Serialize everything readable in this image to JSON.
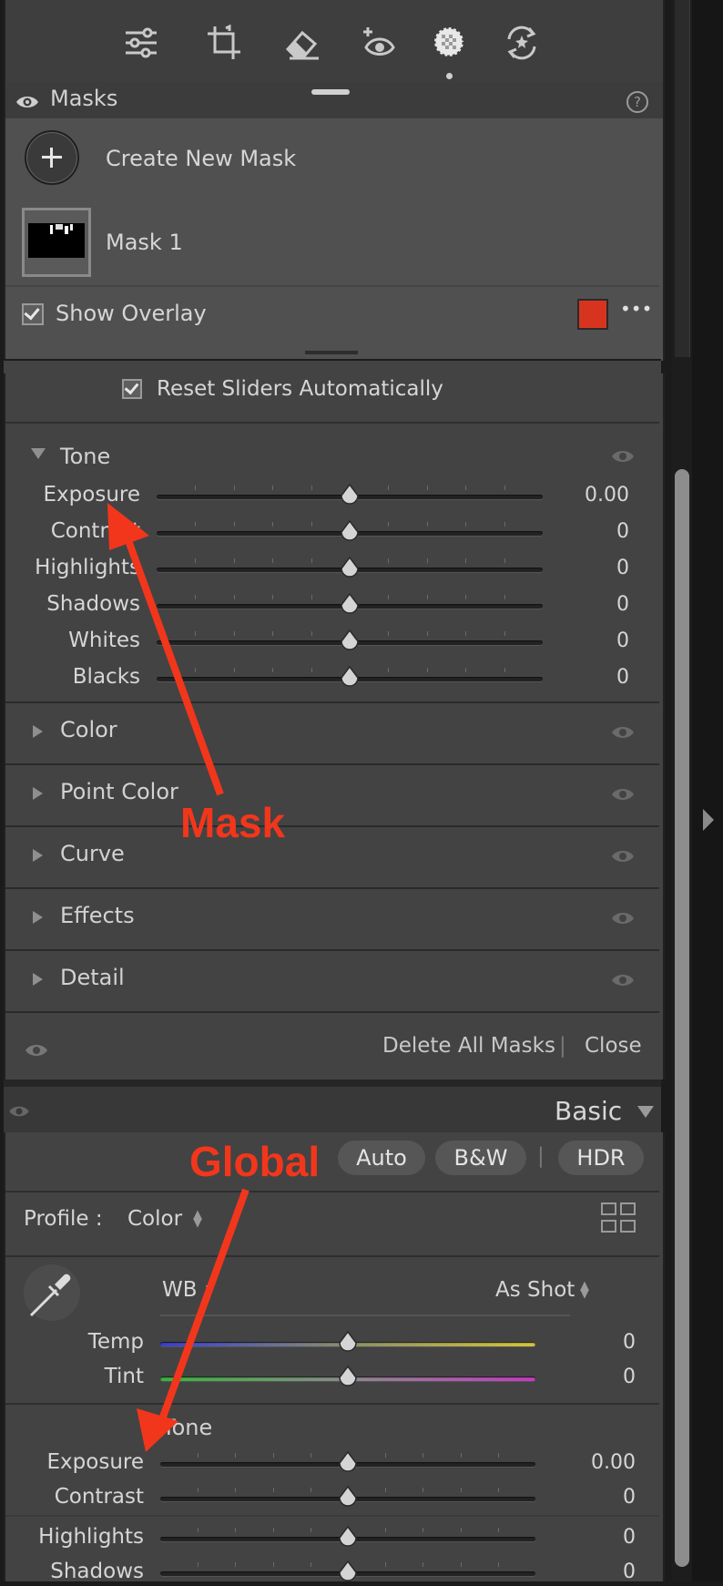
{
  "toolbar": {
    "tools": [
      {
        "icon": "edit-sliders-icon"
      },
      {
        "icon": "crop-icon"
      },
      {
        "icon": "remove-eraser-icon"
      },
      {
        "icon": "red-eye-icon"
      },
      {
        "icon": "masking-icon",
        "active": true
      },
      {
        "icon": "presets-icon"
      }
    ]
  },
  "masks_panel": {
    "title": "Masks",
    "help": "?",
    "create_new_mask": "Create New Mask",
    "mask_item": "Mask 1",
    "show_overlay": "Show Overlay",
    "overlay_color": "#d7341f",
    "more": "•••"
  },
  "mask_adjust": {
    "reset_sliders": "Reset Sliders Automatically",
    "tone_title": "Tone",
    "sliders": [
      {
        "label": "Exposure",
        "value": "0.00"
      },
      {
        "label": "Contrast",
        "value": "0"
      },
      {
        "label": "Highlights",
        "value": "0"
      },
      {
        "label": "Shadows",
        "value": "0"
      },
      {
        "label": "Whites",
        "value": "0"
      },
      {
        "label": "Blacks",
        "value": "0"
      }
    ],
    "sections": [
      "Color",
      "Point Color",
      "Curve",
      "Effects",
      "Detail"
    ],
    "delete_all": "Delete All Masks",
    "divider": "|",
    "close": "Close"
  },
  "basic_panel": {
    "title": "Basic",
    "buttons": {
      "auto": "Auto",
      "bw": "B&W",
      "divider": "|",
      "hdr": "HDR"
    },
    "profile_label": "Profile :",
    "profile_value": "Color",
    "wb_label": "WB :",
    "wb_value": "As Shot",
    "wb_sliders": [
      {
        "label": "Temp",
        "value": "0"
      },
      {
        "label": "Tint",
        "value": "0"
      }
    ],
    "tone_title": "Tone",
    "tone_sliders": [
      {
        "label": "Exposure",
        "value": "0.00"
      },
      {
        "label": "Contrast",
        "value": "0"
      },
      {
        "label": "Highlights",
        "value": "0"
      },
      {
        "label": "Shadows",
        "value": "0"
      }
    ]
  },
  "annotations": {
    "mask_label": "Mask",
    "global_label": "Global",
    "arrow_color": "#f2361c"
  }
}
